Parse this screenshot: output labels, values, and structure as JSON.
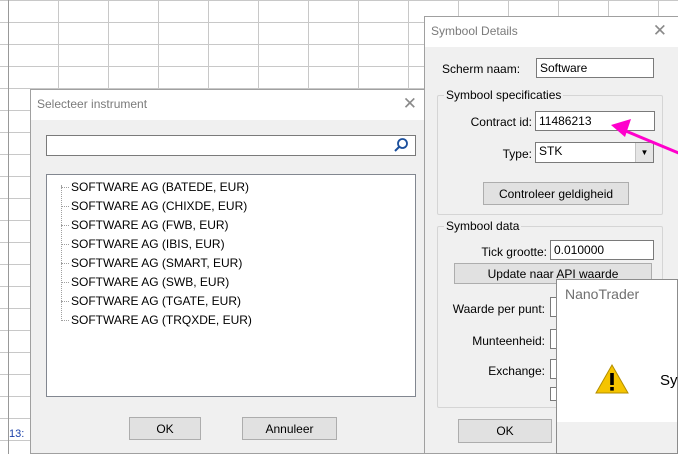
{
  "background": {
    "time_label": "13:"
  },
  "select_dialog": {
    "title": "Selecteer instrument",
    "search_value": "",
    "items": [
      "SOFTWARE AG (BATEDE, EUR)",
      "SOFTWARE AG (CHIXDE, EUR)",
      "SOFTWARE AG (FWB, EUR)",
      "SOFTWARE AG (IBIS, EUR)",
      "SOFTWARE AG (SMART, EUR)",
      "SOFTWARE AG (SWB, EUR)",
      "SOFTWARE AG (TGATE, EUR)",
      "SOFTWARE AG (TRQXDE, EUR)"
    ],
    "ok_label": "OK",
    "cancel_label": "Annuleer"
  },
  "symbol_dialog": {
    "title": "Symbool Details",
    "scherm_naam_label": "Scherm naam:",
    "scherm_naam_value": "Software",
    "spec_group_label": "Symbool specificaties",
    "contract_label": "Contract id:",
    "contract_value": "11486213",
    "type_label": "Type:",
    "type_value": "STK",
    "check_button": "Controleer geldigheid",
    "data_group_label": "Symbool data",
    "tick_label": "Tick grootte:",
    "tick_value": "0.010000",
    "update_button": "Update naar API waarde",
    "waarde_label": "Waarde per punt:",
    "munt_label": "Munteenheid:",
    "exchange_label": "Exchange:",
    "ok_label": "OK"
  },
  "nano_dialog": {
    "title": "NanoTrader",
    "message_partial": "Sy"
  },
  "colors": {
    "annotation_arrow": "#ff00cc",
    "warning": "#f5c400"
  }
}
